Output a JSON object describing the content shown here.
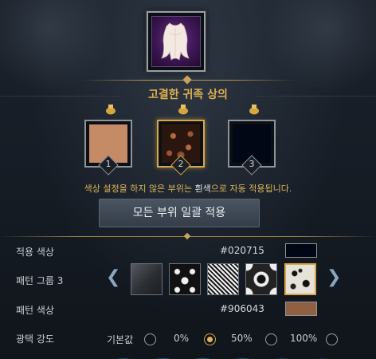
{
  "item": {
    "name": "고결한 귀족 상의",
    "icon": "noble-top-icon"
  },
  "slots": [
    {
      "number": "1",
      "color": "#c58a66",
      "pattern": "solid",
      "selected": false
    },
    {
      "number": "2",
      "color": "#906043",
      "pattern": "swirl",
      "selected": true
    },
    {
      "number": "3",
      "color": "#020715",
      "pattern": "solid",
      "selected": false
    }
  ],
  "notice": {
    "part1": "색상 설정을 하지 않은 부위는 ",
    "part2": "흰색",
    "part3": "으로 자동 적용됩니다."
  },
  "apply_all_label": "모든 부위 일괄 적용",
  "applied_color": {
    "label": "적용 색상",
    "hex": "#020715",
    "swatch": "#020715"
  },
  "pattern_group": {
    "label": "패턴 그룹 3",
    "patterns": [
      "dark-gradient",
      "fleur-de-lis",
      "crosshatch",
      "medallion",
      "baroque"
    ],
    "selected_index": 4
  },
  "pattern_color": {
    "label": "패턴 색상",
    "hex": "#906043",
    "swatch": "#906043"
  },
  "gloss": {
    "label": "광택 강도",
    "options": [
      "기본값",
      "0%",
      "50%",
      "100%"
    ],
    "selected_index": 1
  }
}
